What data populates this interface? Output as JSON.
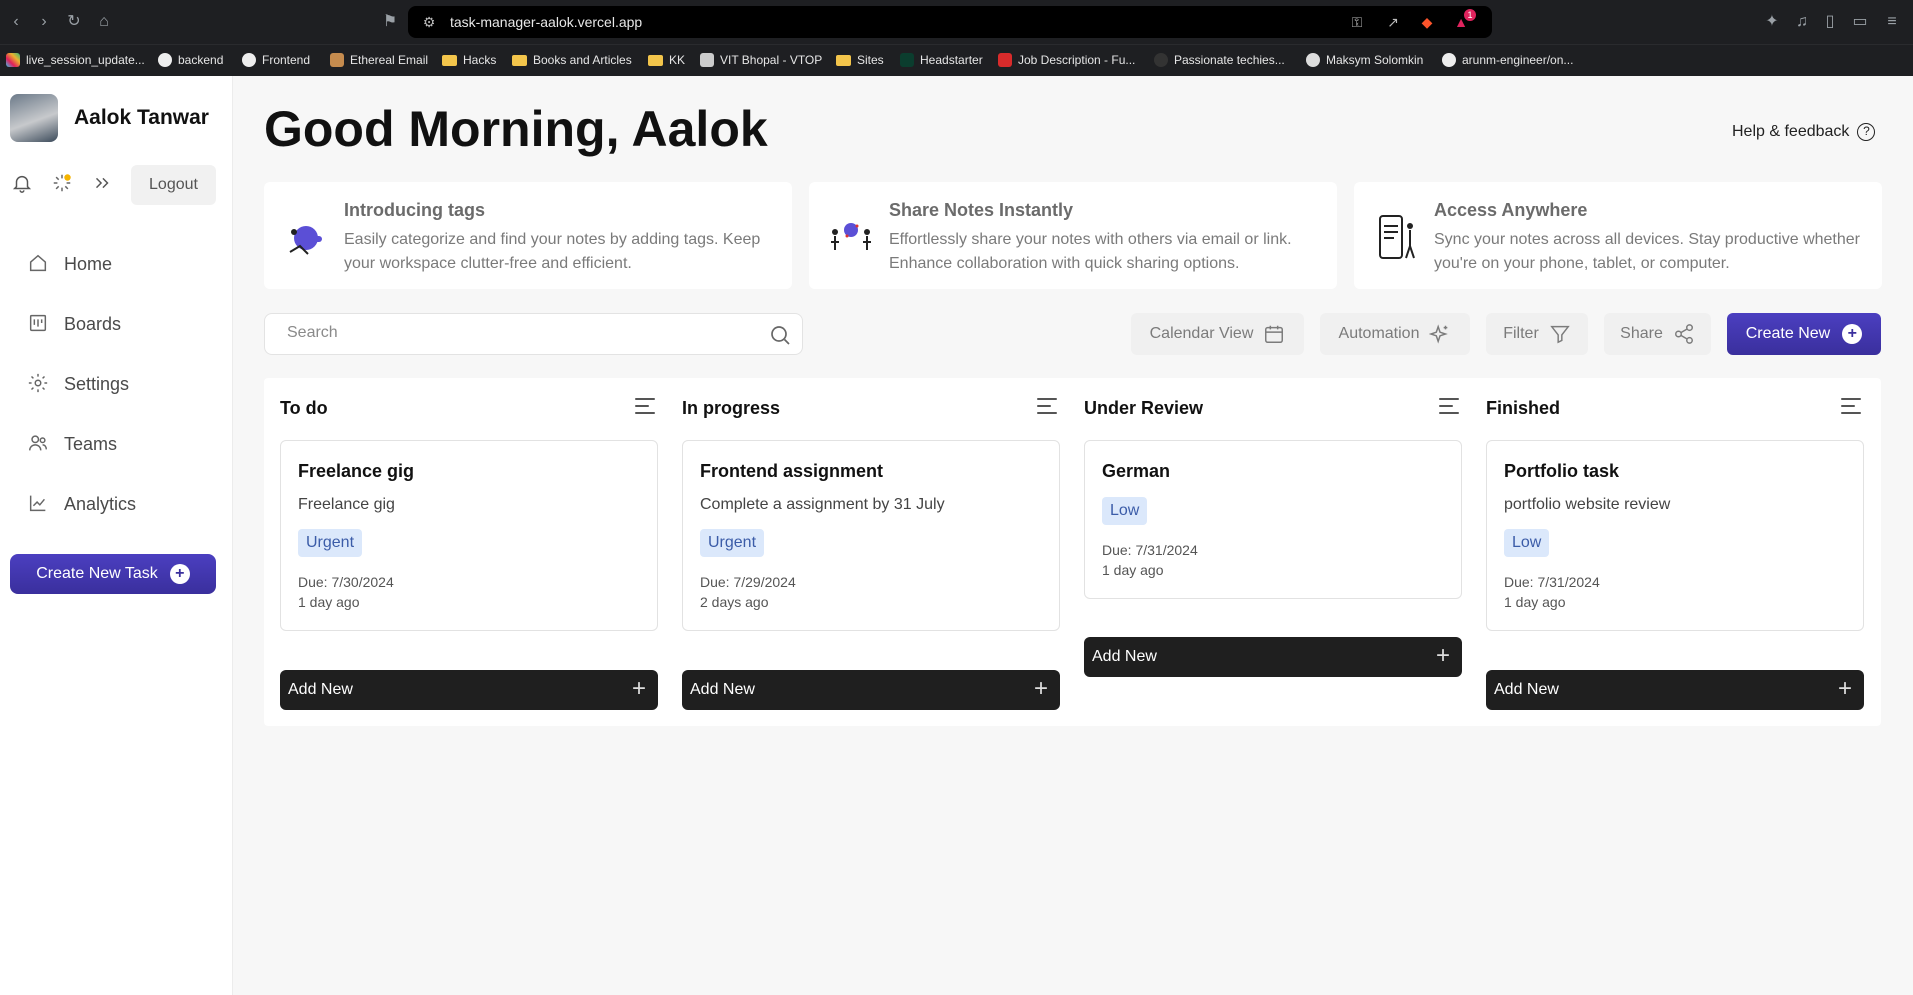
{
  "browser": {
    "url": "task-manager-aalok.vercel.app",
    "notification_count": "1",
    "bookmarks": [
      "live_session_update...",
      "backend",
      "Frontend",
      "Ethereal Email",
      "Hacks",
      "Books and Articles",
      "KK",
      "VIT Bhopal - VTOP",
      "Sites",
      "Headstarter",
      "Job Description - Fu...",
      "Passionate techies...",
      "Maksym Solomkin",
      "arunm-engineer/on..."
    ]
  },
  "sidebar": {
    "user_name": "Aalok Tanwar",
    "logout_label": "Logout",
    "items": [
      {
        "label": "Home",
        "icon": "home-icon"
      },
      {
        "label": "Boards",
        "icon": "boards-icon"
      },
      {
        "label": "Settings",
        "icon": "gear-icon"
      },
      {
        "label": "Teams",
        "icon": "users-icon"
      },
      {
        "label": "Analytics",
        "icon": "chart-icon"
      }
    ],
    "create_task_label": "Create New Task"
  },
  "header": {
    "greeting": "Good Morning, Aalok",
    "help_label": "Help & feedback"
  },
  "features": [
    {
      "title": "Introducing tags",
      "desc": "Easily categorize and find your notes by adding tags. Keep your workspace clutter-free and efficient."
    },
    {
      "title": "Share Notes Instantly",
      "desc": "Effortlessly share your notes with others via email or link. Enhance collaboration with quick sharing options."
    },
    {
      "title": "Access Anywhere",
      "desc": "Sync your notes across all devices. Stay productive whether you're on your phone, tablet, or computer."
    }
  ],
  "toolbar": {
    "search_placeholder": "Search",
    "calendar_label": "Calendar View",
    "automation_label": "Automation",
    "filter_label": "Filter",
    "share_label": "Share",
    "create_new_label": "Create New"
  },
  "board": {
    "add_new_label": "Add New",
    "columns": [
      {
        "title": "To do",
        "card": {
          "title": "Freelance gig",
          "desc": "Freelance gig",
          "tag": "Urgent",
          "due": "Due: 7/30/2024",
          "ago": "1 day ago"
        }
      },
      {
        "title": "In progress",
        "card": {
          "title": "Frontend assignment",
          "desc": "Complete a assignment by 31 July",
          "tag": "Urgent",
          "due": "Due: 7/29/2024",
          "ago": "2 days ago"
        }
      },
      {
        "title": "Under Review",
        "card": {
          "title": "German",
          "desc": "",
          "tag": "Low",
          "due": "Due: 7/31/2024",
          "ago": "1 day ago"
        }
      },
      {
        "title": "Finished",
        "card": {
          "title": "Portfolio task",
          "desc": "portfolio website review",
          "tag": "Low",
          "due": "Due: 7/31/2024",
          "ago": "1 day ago"
        }
      }
    ]
  },
  "colors": {
    "accent": "#3a2f9d",
    "tag_bg": "#dbe8fb",
    "tag_text": "#3b5ca8",
    "dark_button": "#1f1f1f"
  }
}
